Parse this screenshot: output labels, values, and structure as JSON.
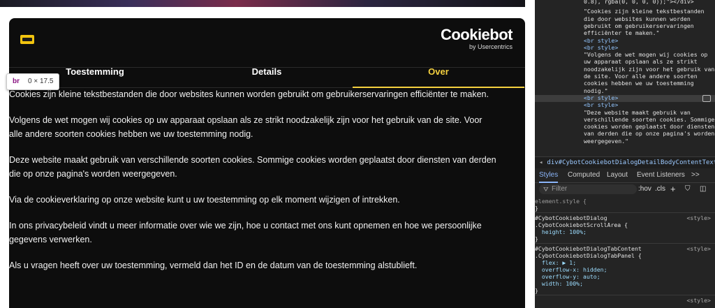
{
  "dialog": {
    "brand_line1": "Cookiebot",
    "brand_line2": "by Usercentrics",
    "tabs": [
      "Toestemming",
      "Details",
      "Over"
    ],
    "paragraphs": [
      "Cookies zijn kleine tekstbestanden die door websites kunnen worden gebruikt om gebruikerservaringen efficiënter te maken.",
      "Volgens de wet mogen wij cookies op uw apparaat opslaan als ze strikt noodzakelijk zijn voor het gebruik van de site. Voor alle andere soorten cookies hebben we uw toestemming nodig.",
      "Deze website maakt gebruik van verschillende soorten cookies. Sommige cookies worden geplaatst door diensten van derden die op onze pagina's worden weergegeven.",
      "Via de cookieverklaring op onze website kunt u uw toestemming op elk moment wijzigen of intrekken.",
      "In ons privacybeleid vindt u meer informatie over wie we zijn, hoe u contact met ons kunt opnemen en hoe we persoonlijke gegevens verwerken.",
      "Als u vragen heeft over uw toestemming, vermeld dan het ID en de datum van de toestemming alstublieft."
    ]
  },
  "inspect_badge": {
    "tag": "br",
    "size": "0 × 17.5"
  },
  "devtools": {
    "code_lines": [
      "0.8), rgba(0, 0, 0, 0));\"></div>",
      "\"Cookies zijn kleine tekstbestanden",
      "die door websites kunnen worden",
      "gebruikt om gebruikerservaringen",
      "efficiënter te maken.\"",
      "<br style>",
      "<br style>",
      "\"Volgens de wet mogen wij cookies op",
      "uw apparaat opslaan als ze strikt",
      "noodzakelijk zijn voor het gebruik van",
      "de site. Voor alle andere soorten",
      "cookies hebben we uw toestemming",
      "nodig.\"",
      "<br style>",
      "<br style>",
      "\"Deze website maakt gebruik van",
      "verschillende soorten cookies. Sommige",
      "cookies worden geplaatst door diensten",
      "van derden die op onze pagina's worden",
      "weergegeven.\""
    ],
    "breadcrumb": "div#CybotCookiebotDialogDetailBodyContentTextAbou",
    "tabs": [
      "Styles",
      "Computed",
      "Layout",
      "Event Listeners",
      ">>"
    ],
    "filter_placeholder": "Filter",
    "filter_tools": [
      ":hov",
      ".cls",
      "+"
    ],
    "style_lines": [
      {
        "text": "element.style {",
        "src": ""
      },
      {
        "text": "}",
        "src": ""
      },
      {
        "text": "#CybotCookiebotDialog",
        "src": "<style>"
      },
      {
        "text": ".CybotCookiebotScrollArea {",
        "src": ""
      },
      {
        "text": "  height: 100%;",
        "src": ""
      },
      {
        "text": "}",
        "src": ""
      },
      {
        "text": "#CybotCookiebotDialogTabContent",
        "src": "<style>"
      },
      {
        "text": ".CybotCookiebotDialogTabPanel {",
        "src": ""
      },
      {
        "text": "  flex: ▶ 1;",
        "src": ""
      },
      {
        "text": "  overflow-x: hidden;",
        "src": ""
      },
      {
        "text": "  overflow-y: auto;",
        "src": ""
      },
      {
        "text": "  width: 100%;",
        "src": ""
      },
      {
        "text": "}",
        "src": ""
      },
      {
        "text": "",
        "src": "<style>"
      }
    ]
  }
}
